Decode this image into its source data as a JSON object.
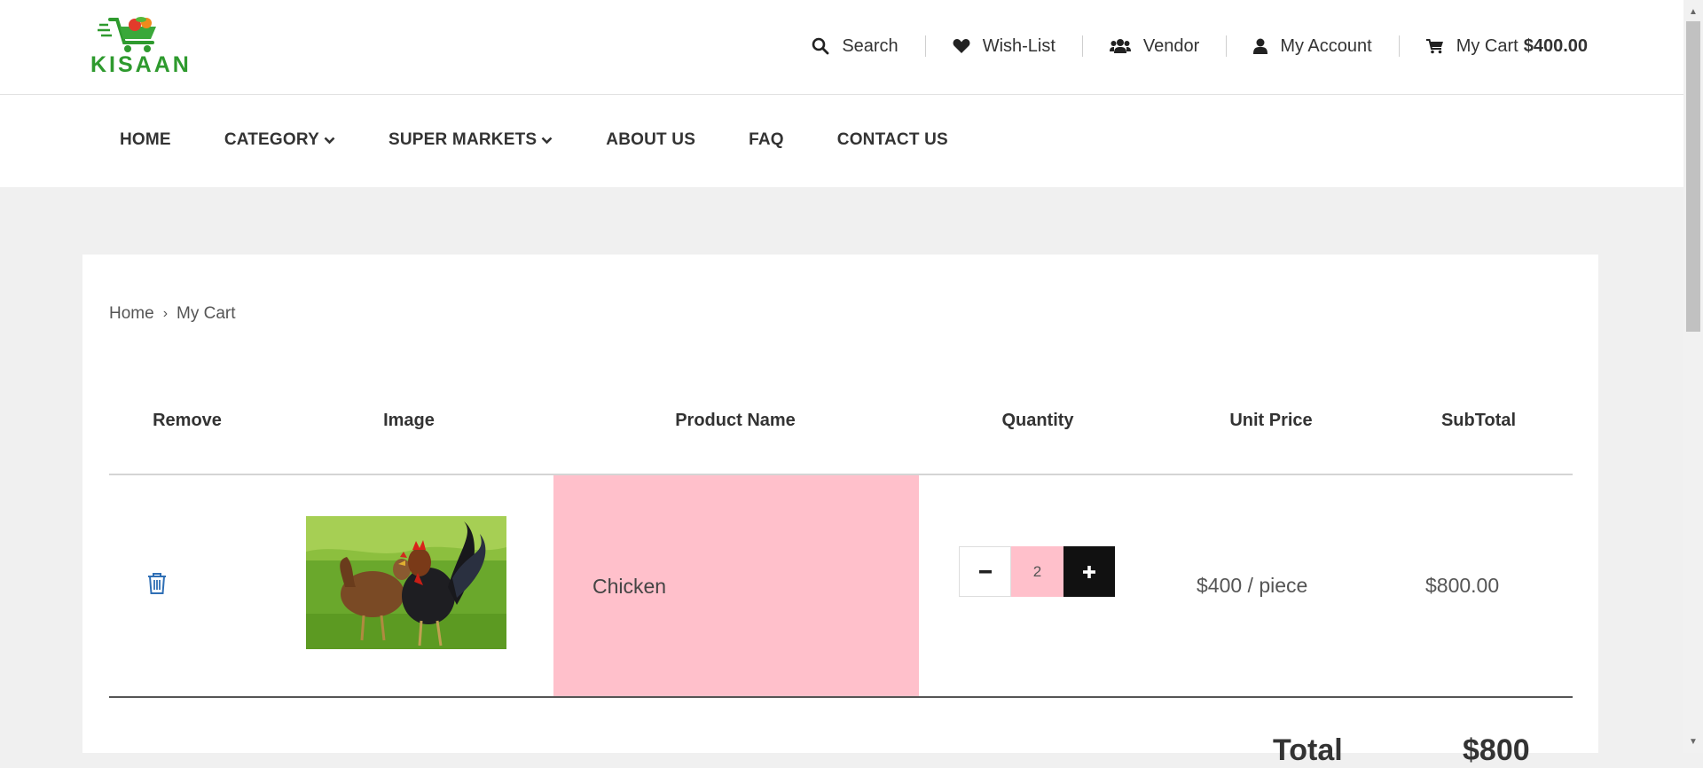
{
  "brand": {
    "name": "KISAAN"
  },
  "top_links": {
    "search": "Search",
    "wishlist": "Wish-List",
    "vendor": "Vendor",
    "account": "My Account",
    "cart_label": "My Cart",
    "cart_total": "$400.00"
  },
  "nav": {
    "home": "HOME",
    "category": "CATEGORY",
    "supermarkets": "SUPER MARKETS",
    "about": "ABOUT US",
    "faq": "FAQ",
    "contact": "CONTACT US"
  },
  "breadcrumb": {
    "home": "Home",
    "current": "My Cart"
  },
  "table": {
    "headers": {
      "remove": "Remove",
      "image": "Image",
      "product_name": "Product Name",
      "quantity": "Quantity",
      "unit_price": "Unit Price",
      "subtotal": "SubTotal"
    },
    "rows": [
      {
        "product_name": "Chicken",
        "quantity": "2",
        "unit_price": "$400 / piece",
        "subtotal": "$800.00"
      }
    ]
  },
  "totals": {
    "label": "Total",
    "value": "$800"
  },
  "icons": {
    "search": "search-icon",
    "wishlist": "heart-icon",
    "vendor": "users-icon",
    "account": "user-icon",
    "cart": "cart-icon",
    "remove": "trash-icon",
    "minus": "minus-icon",
    "plus": "plus-icon"
  },
  "colors": {
    "brand_green": "#2e9a2e",
    "highlight_pink": "#ffc0cb",
    "trash_blue": "#2f6fb5",
    "plus_bg": "#111111"
  }
}
